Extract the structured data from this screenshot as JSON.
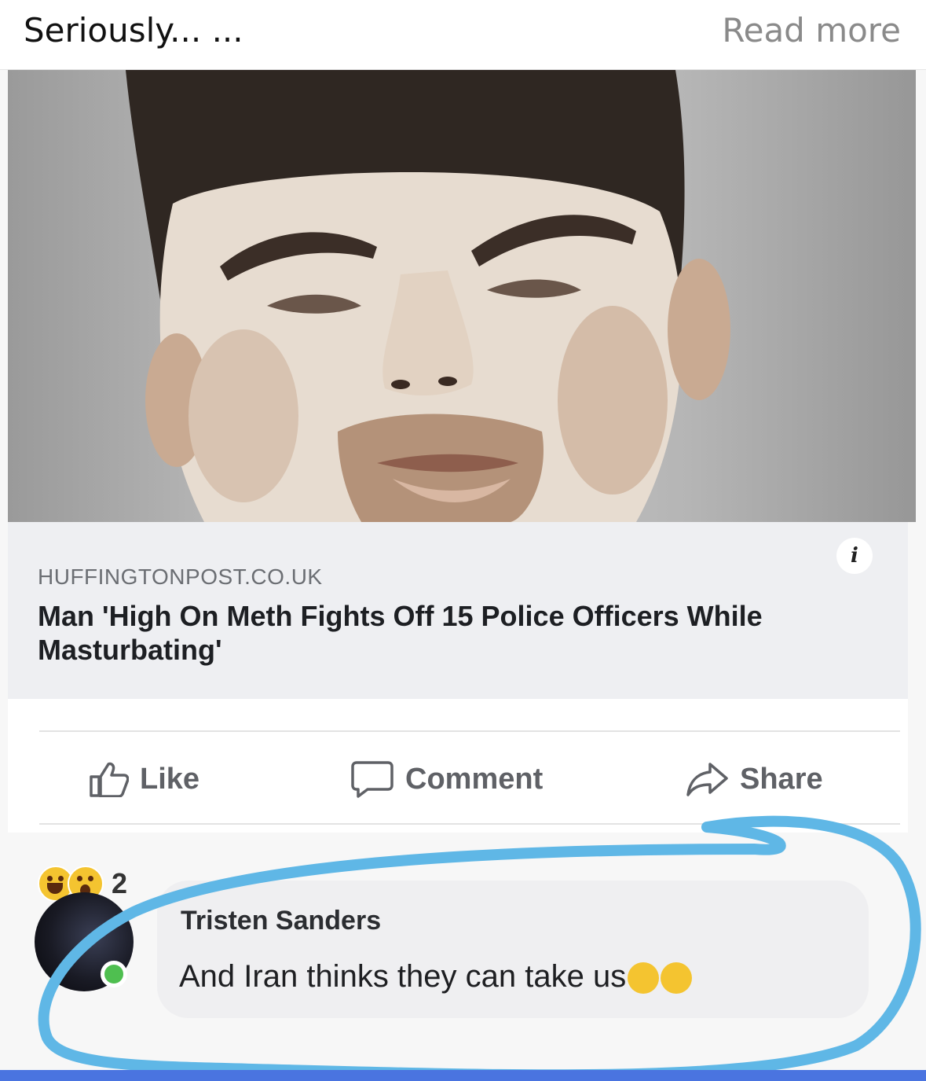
{
  "header": {
    "title": "Seriously... ...",
    "read_more": "Read more"
  },
  "link_preview": {
    "domain": "HUFFINGTONPOST.CO.UK",
    "headline": "Man 'High On Meth Fights Off 15 Police Officers While Masturbating'",
    "info_icon": "i"
  },
  "actions": {
    "like": "Like",
    "comment": "Comment",
    "share": "Share"
  },
  "reactions": {
    "icons": [
      "laugh-emoji",
      "wow-emoji"
    ],
    "count": "2"
  },
  "comment": {
    "author": "Tristen Sanders",
    "text": "And Iran thinks they can take us"
  },
  "colors": {
    "annotation": "#5fb7e6",
    "bottom_bar": "#4a74e0",
    "online": "#4fbf50"
  }
}
